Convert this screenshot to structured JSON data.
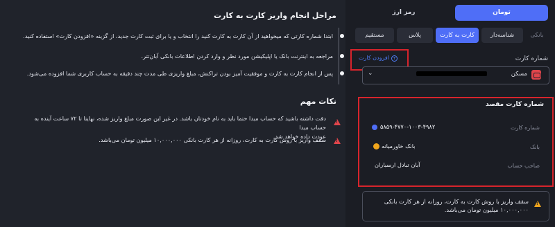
{
  "left": {
    "steps_title": "مراحل انجام واریز کارت به کارت",
    "steps": [
      "ابتدا شماره کارتی که میخواهید از آن کارت به کارت کنید را انتخاب و یا برای ثبت کارت جدید، از گزینه «افزودن کارت» استفاده کنید.",
      "مراجعه به اینترنت بانک یا اپلیکیشن مورد نظر و وارد کردن اطلاعات بانکی آبان‌تتر.",
      "پس از انجام کارت به کارت و موفقیت آمیز بودن تراکنش، مبلغ واریزی طی مدت چند دقیقه به حساب کاربری شما افزوده می‌شود."
    ],
    "notes_title": "نکات مهم",
    "notes": [
      "دقت داشته باشید که حساب مبدا حتما باید به نام خودتان باشد. در غیر این صورت مبلغ واریز شده، نهایتا تا ۷۲ ساعت آینده به حساب مبدا",
      "عودت داده خواهد شد.",
      "سقف واریز با روش کارت به کارت، روزانه از هر کارت بانکی ۱۰,۰۰۰,۰۰۰ میلیون تومان می‌باشد."
    ]
  },
  "currency_tabs": [
    "تومان",
    "رمز ارز"
  ],
  "payment_tabs": [
    "بانکی",
    "شناسه‌دار",
    "کارت به کارت",
    "پلاس",
    "مستقیم"
  ],
  "card": {
    "label": "شماره کارت",
    "add_card": "افزودن کارت",
    "bank_name": "مسکن"
  },
  "destination": {
    "title": "شماره کارت مقصد",
    "card_number_label": "شماره کارت",
    "card_number": "۵۸۵۹-۴۷۷۰-۱۰۰۳-۴۹۸۲",
    "bank_label": "بانک",
    "bank_value": "بانک خاورمیانه",
    "owner_label": "صاحب حساب",
    "owner_value": "آبان تبادل ارسباران"
  },
  "notice": {
    "line1": "سقف واریز با روش کارت به کارت، روزانه از هر کارت بانکی",
    "line2": "۱۰,۰۰۰,۰۰۰ میلیون تومان می‌باشد."
  },
  "colors": {
    "accent": "#4f6ef7",
    "warning": "#e0454b",
    "highlight_box": "#d8242c",
    "notice_icon": "#f0a51c"
  }
}
